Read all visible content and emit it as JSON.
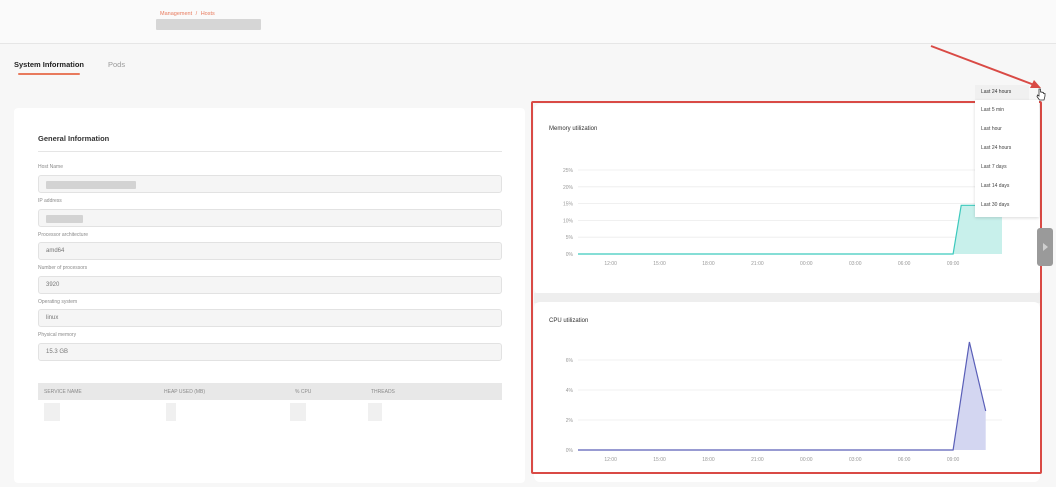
{
  "breadcrumb": {
    "parent": "Management",
    "separator": "/",
    "current": "Hosts"
  },
  "tabs": [
    {
      "label": "System Information",
      "active": true
    },
    {
      "label": "Pods",
      "active": false
    }
  ],
  "general_info": {
    "title": "General Information",
    "fields": [
      {
        "label": "Host Name",
        "value": ""
      },
      {
        "label": "IP address",
        "value": ""
      },
      {
        "label": "Processor architecture",
        "value": "amd64"
      },
      {
        "label": "Number of processors",
        "value": "3920"
      },
      {
        "label": "Operating system",
        "value": "linux"
      },
      {
        "label": "Physical memory",
        "value": "15.3 GB"
      }
    ]
  },
  "service_table": {
    "columns": [
      "SERVICE NAME",
      "HEAP USED (MB)",
      "% CPU",
      "THREADS"
    ]
  },
  "time_range": {
    "selected": "Last 24 hours",
    "options": [
      "Last 5 min",
      "Last hour",
      "Last 24 hours",
      "Last 7 days",
      "Last 14 days",
      "Last 30 days"
    ]
  },
  "colors": {
    "accent": "#e87a5d",
    "highlight": "#d94a45",
    "memory_line": "#3cc9bd",
    "memory_fill": "#c8f0eb",
    "cpu_line": "#5a5fb8",
    "cpu_fill": "#d3d6f1"
  },
  "chart_data": [
    {
      "type": "area",
      "title": "Memory utilization",
      "x": [
        "12:00",
        "15:00",
        "18:00",
        "21:00",
        "00:00",
        "03:00",
        "06:00",
        "09:00"
      ],
      "y_ticks": [
        "0%",
        "5%",
        "10%",
        "15%",
        "20%",
        "25%"
      ],
      "ylim": [
        0,
        25
      ],
      "xlim_hours": [
        10,
        12.5
      ],
      "series": [
        {
          "points": [
            [
              "10:00",
              0
            ],
            [
              "09:00",
              0
            ],
            [
              "09:30",
              14.5
            ],
            [
              "10:00",
              14.5
            ],
            [
              "12:00",
              14.5
            ]
          ]
        }
      ],
      "grid": true
    },
    {
      "type": "area",
      "title": "CPU utilization",
      "x": [
        "12:00",
        "15:00",
        "18:00",
        "21:00",
        "00:00",
        "03:00",
        "06:00",
        "09:00"
      ],
      "y_ticks": [
        "0%",
        "2%",
        "4%",
        "6%"
      ],
      "ylim": [
        0,
        6
      ],
      "series": [
        {
          "points": [
            [
              "10:00",
              0
            ],
            [
              "09:00",
              0
            ],
            [
              "10:00",
              7.2
            ],
            [
              "11:00",
              2.6
            ]
          ]
        }
      ],
      "grid": true
    }
  ]
}
